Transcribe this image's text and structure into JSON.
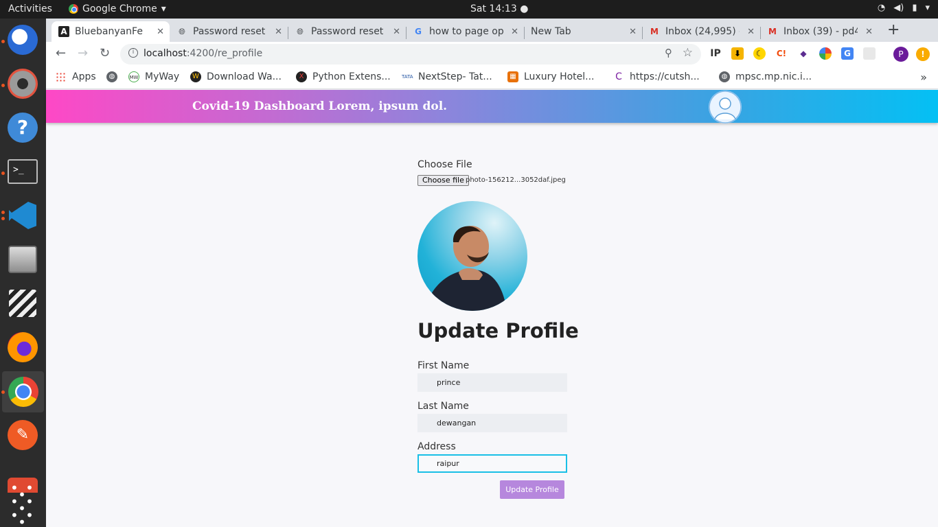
{
  "os": {
    "activities": "Activities",
    "app_name": "Google Chrome",
    "clock": "Sat 14:13"
  },
  "browser": {
    "tabs": [
      {
        "title": "BluebanyanFe",
        "icon": "angular-icon"
      },
      {
        "title": "Password reset",
        "icon": "globe-icon"
      },
      {
        "title": "Password reset",
        "icon": "globe-icon"
      },
      {
        "title": "how to page op",
        "icon": "google-icon"
      },
      {
        "title": "New Tab",
        "icon": ""
      },
      {
        "title": "Inbox (24,995) -",
        "icon": "gmail-icon"
      },
      {
        "title": "Inbox (39) - pd4",
        "icon": "gmail-icon"
      }
    ],
    "url_host": "localhost",
    "url_path": ":4200/re_profile",
    "bookmarks": [
      "Apps",
      "",
      "MyWay",
      "Download Wa...",
      "Python Extens...",
      "NextStep- Tat...",
      "Luxury Hotel...",
      "https://cutsh...",
      "mpsc.mp.nic.i..."
    ],
    "profile_initial": "P",
    "extensions": [
      "IP"
    ]
  },
  "app": {
    "brand": "Covid-19 Dashboard Lorem, ipsum dol.",
    "choose_file_label": "Choose File",
    "choose_file_button": "Choose file",
    "file_name": "photo-156212...3052daf.jpeg",
    "heading": "Update Profile",
    "first_name_label": "First Name",
    "first_name_value": "prince",
    "last_name_label": "Last Name",
    "last_name_value": "dewangan",
    "address_label": "Address",
    "address_value": "raipur",
    "submit_label": "Update Profile"
  },
  "colors": {
    "header_gradient_start": "#fe48c6",
    "header_gradient_end": "#04c0f4",
    "submit_button": "#b687dd",
    "focus_border": "#18bfe6"
  }
}
